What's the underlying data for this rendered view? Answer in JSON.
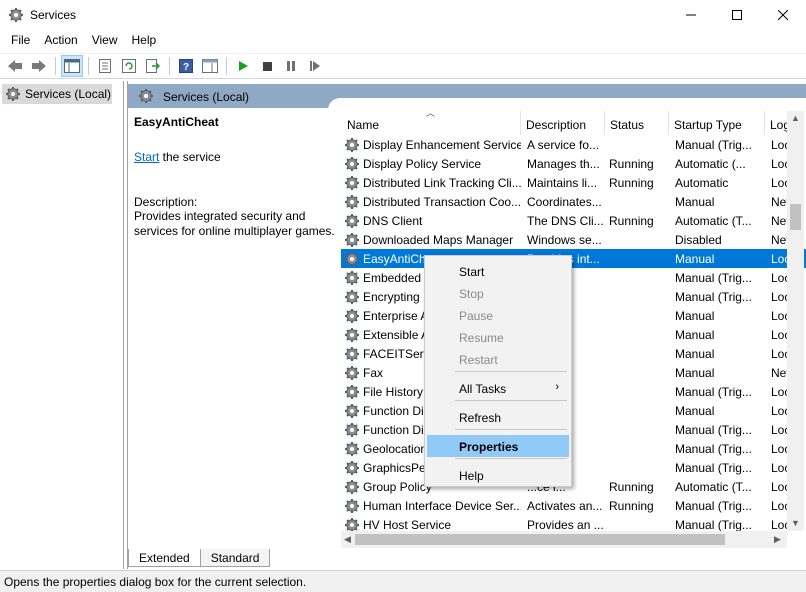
{
  "window": {
    "title": "Services",
    "icon": "gear-icon"
  },
  "menu": [
    "File",
    "Action",
    "View",
    "Help"
  ],
  "tree": {
    "root_label": "Services (Local)"
  },
  "header": {
    "title": "Services (Local)"
  },
  "description_pane": {
    "service_name": "EasyAntiCheat",
    "start_link": "Start",
    "start_suffix": " the service",
    "desc_label": "Description:",
    "desc_text": "Provides integrated security and services for online multiplayer games."
  },
  "columns": [
    "Name",
    "Description",
    "Status",
    "Startup Type",
    "Log"
  ],
  "services": [
    {
      "name": "Display Enhancement Service",
      "desc": "A service fo...",
      "status": "",
      "startup": "Manual (Trig...",
      "log": "Loca"
    },
    {
      "name": "Display Policy Service",
      "desc": "Manages th...",
      "status": "Running",
      "startup": "Automatic (...",
      "log": "Loca"
    },
    {
      "name": "Distributed Link Tracking Cli...",
      "desc": "Maintains li...",
      "status": "Running",
      "startup": "Automatic",
      "log": "Loca"
    },
    {
      "name": "Distributed Transaction Coo...",
      "desc": "Coordinates...",
      "status": "",
      "startup": "Manual",
      "log": "Netw"
    },
    {
      "name": "DNS Client",
      "desc": "The DNS Cli...",
      "status": "Running",
      "startup": "Automatic (T...",
      "log": "Netw"
    },
    {
      "name": "Downloaded Maps Manager",
      "desc": "Windows se...",
      "status": "",
      "startup": "Disabled",
      "log": "Netw"
    },
    {
      "name": "EasyAntiCheat",
      "desc": "Provides int...",
      "status": "",
      "startup": "Manual",
      "log": "Loca",
      "selected": true
    },
    {
      "name": "Embedded",
      "desc": "...ed...",
      "status": "",
      "startup": "Manual (Trig...",
      "log": "Loca"
    },
    {
      "name": "Encrypting",
      "desc": "...th...",
      "status": "",
      "startup": "Manual (Trig...",
      "log": "Loca"
    },
    {
      "name": "Enterprise A",
      "desc": "...",
      "status": "",
      "startup": "Manual",
      "log": "Loca"
    },
    {
      "name": "Extensible A",
      "desc": "...nsi...",
      "status": "",
      "startup": "Manual",
      "log": "Loca"
    },
    {
      "name": "FACEITServi",
      "desc": "...eat ...",
      "status": "",
      "startup": "Manual",
      "log": "Loca"
    },
    {
      "name": "Fax",
      "desc": "...you...",
      "status": "",
      "startup": "Manual",
      "log": "Netw"
    },
    {
      "name": "File History",
      "desc": "...use...",
      "status": "",
      "startup": "Manual (Trig...",
      "log": "Loca"
    },
    {
      "name": "Function Di",
      "desc": "...HO...",
      "status": "",
      "startup": "Manual",
      "log": "Loca"
    },
    {
      "name": "Function Di",
      "desc": "...lic...",
      "status": "",
      "startup": "Manual (Trig...",
      "log": "Loca"
    },
    {
      "name": "Geolocation",
      "desc": "...ice ...",
      "status": "",
      "startup": "Manual (Trig...",
      "log": "Loca"
    },
    {
      "name": "GraphicsPer",
      "desc": "...pe...",
      "status": "",
      "startup": "Manual (Trig...",
      "log": "Loca"
    },
    {
      "name": "Group Policy",
      "desc": "...ce i...",
      "status": "Running",
      "startup": "Automatic (T...",
      "log": "Loca"
    },
    {
      "name": "Human Interface Device Ser...",
      "desc": "Activates an...",
      "status": "Running",
      "startup": "Manual (Trig...",
      "log": "Loca"
    },
    {
      "name": "HV Host Service",
      "desc": "Provides an ...",
      "status": "",
      "startup": "Manual (Trig...",
      "log": "Loca"
    }
  ],
  "context_menu": {
    "items": [
      {
        "label": "Start",
        "disabled": false
      },
      {
        "label": "Stop",
        "disabled": true
      },
      {
        "label": "Pause",
        "disabled": true
      },
      {
        "label": "Resume",
        "disabled": true
      },
      {
        "label": "Restart",
        "disabled": true
      },
      {
        "label": "All Tasks",
        "disabled": false
      },
      {
        "label": "Refresh",
        "disabled": false
      },
      {
        "label": "Properties",
        "disabled": false,
        "highlighted": true
      },
      {
        "label": "Help",
        "disabled": false
      }
    ]
  },
  "tabs": [
    "Extended",
    "Standard"
  ],
  "status_text": "Opens the properties dialog box for the current selection.",
  "colors": {
    "selection": "#0078d7",
    "header_band": "#8fa8c4",
    "menu_highlight": "#91c9f7"
  }
}
